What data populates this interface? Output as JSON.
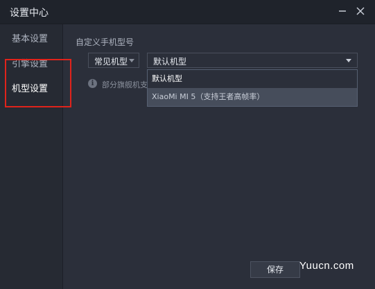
{
  "window": {
    "title": "设置中心"
  },
  "sidebar": {
    "items": [
      {
        "label": "基本设置"
      },
      {
        "label": "引擎设置"
      },
      {
        "label": "机型设置"
      }
    ]
  },
  "content": {
    "section_label": "自定义手机型号",
    "category_select": {
      "value": "常见机型"
    },
    "model_select": {
      "value": "默认机型"
    },
    "hint": "部分旗舰机支",
    "dropdown_options": [
      {
        "label": "默认机型"
      },
      {
        "label": "XiaoMi MI 5（支持王者高帧率）"
      }
    ],
    "save_label": "保存"
  },
  "watermark": "Yuucn.com",
  "colors": {
    "highlight_box": "#e0231b",
    "background": "#2b2f3a"
  }
}
